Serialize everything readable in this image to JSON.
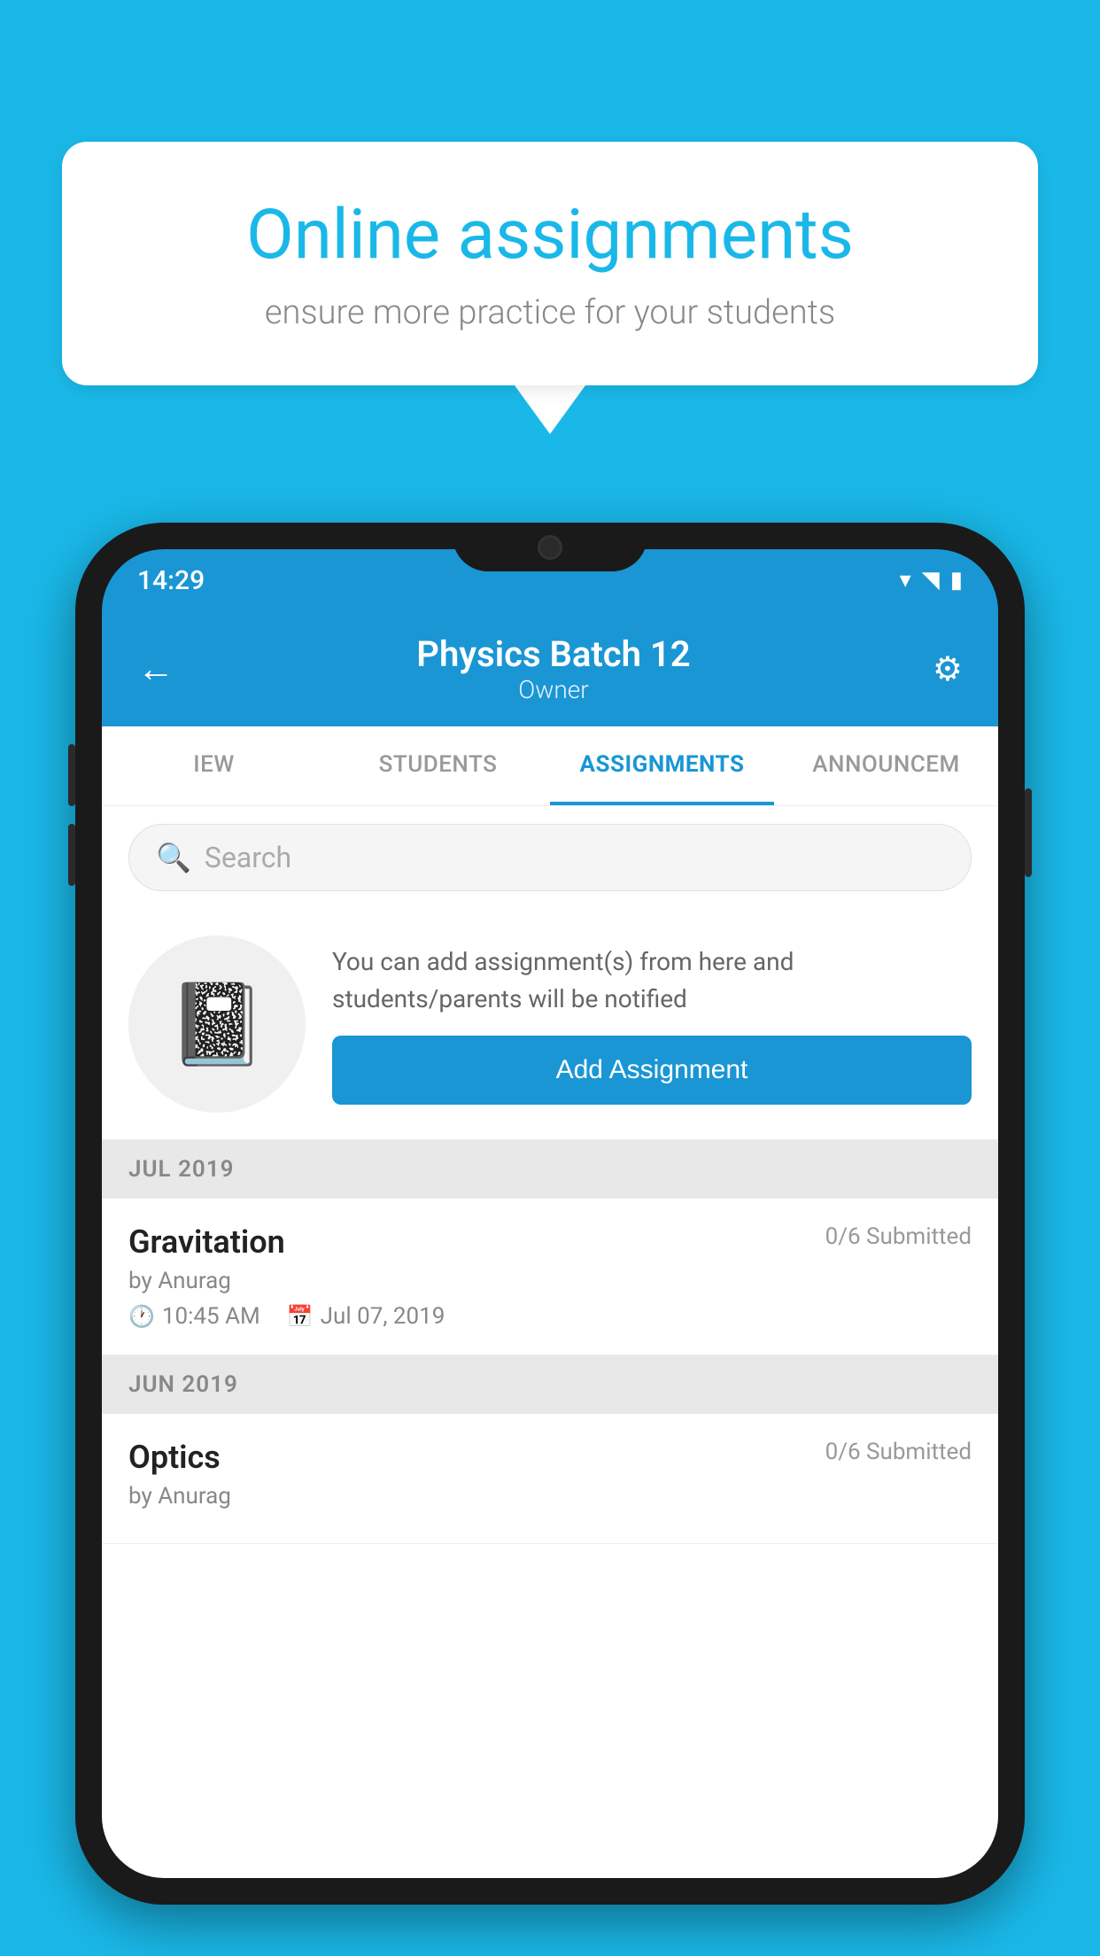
{
  "background_color": "#1ab8e8",
  "speech_bubble": {
    "title": "Online assignments",
    "subtitle": "ensure more practice for your students"
  },
  "phone": {
    "status_bar": {
      "time": "14:29",
      "icons": [
        "wifi",
        "signal",
        "battery"
      ]
    },
    "header": {
      "title": "Physics Batch 12",
      "subtitle": "Owner",
      "back_label": "←",
      "settings_label": "⚙"
    },
    "tabs": [
      {
        "label": "IEW",
        "active": false
      },
      {
        "label": "STUDENTS",
        "active": false
      },
      {
        "label": "ASSIGNMENTS",
        "active": true
      },
      {
        "label": "ANNOUNCEM",
        "active": false
      }
    ],
    "search": {
      "placeholder": "Search"
    },
    "promo": {
      "text": "You can add assignment(s) from here and students/parents will be notified",
      "button_label": "Add Assignment"
    },
    "sections": [
      {
        "header": "JUL 2019",
        "assignments": [
          {
            "name": "Gravitation",
            "submitted": "0/6 Submitted",
            "by": "by Anurag",
            "time": "10:45 AM",
            "date": "Jul 07, 2019"
          }
        ]
      },
      {
        "header": "JUN 2019",
        "assignments": [
          {
            "name": "Optics",
            "submitted": "0/6 Submitted",
            "by": "by Anurag",
            "time": "",
            "date": ""
          }
        ]
      }
    ]
  }
}
